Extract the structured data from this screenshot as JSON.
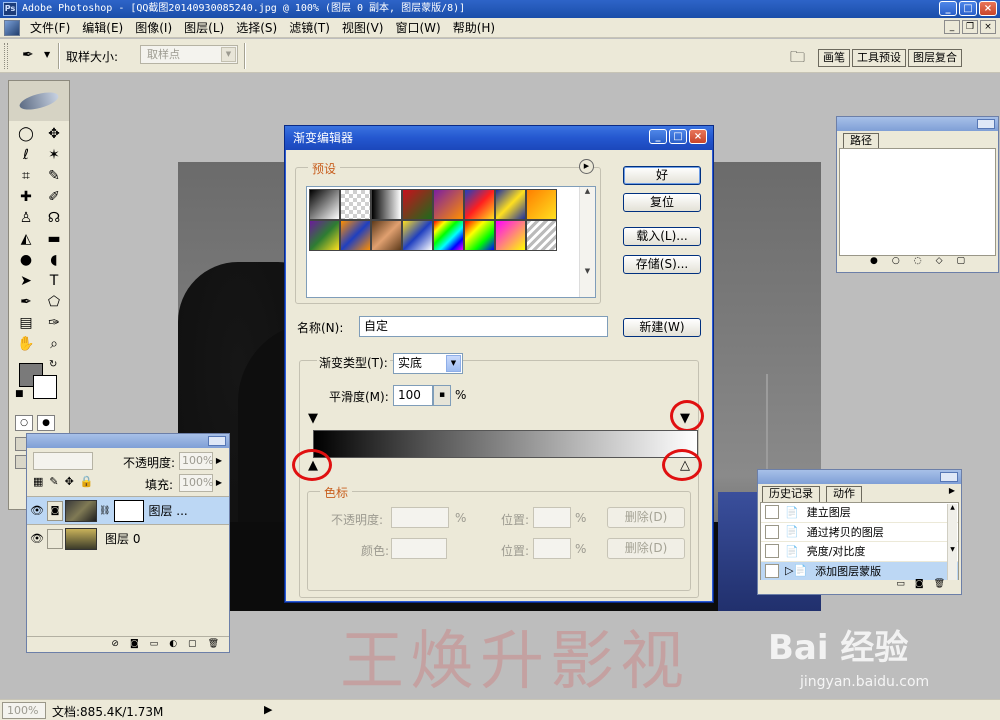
{
  "window": {
    "title": "Adobe Photoshop - [QQ截图20140930085240.jpg @ 100% (图层 0 副本, 图层蒙版/8)]"
  },
  "menu": {
    "items": [
      "文件(F)",
      "编辑(E)",
      "图像(I)",
      "图层(L)",
      "选择(S)",
      "滤镜(T)",
      "视图(V)",
      "窗口(W)",
      "帮助(H)"
    ]
  },
  "options_bar": {
    "sample_size_label": "取样大小:",
    "sample_size_value": "取样点",
    "well_tabs": [
      "画笔",
      "工具预设",
      "图层复合"
    ]
  },
  "toolbox": {
    "tools": [
      "marquee-icon",
      "move-icon",
      "lasso-icon",
      "magic-wand-icon",
      "crop-icon",
      "slice-icon",
      "healing-icon",
      "brush-icon",
      "stamp-icon",
      "history-brush-icon",
      "eraser-icon",
      "gradient-icon",
      "blur-icon",
      "dodge-icon",
      "path-select-icon",
      "type-icon",
      "pen-icon",
      "shape-icon",
      "notes-icon",
      "eyedropper-icon",
      "hand-icon",
      "zoom-icon"
    ],
    "foreground_color": "#7a7a7a",
    "background_color": "#ffffff"
  },
  "layers_panel": {
    "opacity_label": "不透明度:",
    "opacity_value": "100%",
    "fill_label": "填充:",
    "fill_value": "100%",
    "layers": [
      {
        "name": "图层 ...",
        "selected": true,
        "has_mask": true
      },
      {
        "name": "图层 0",
        "selected": false,
        "has_mask": false
      }
    ]
  },
  "paths_panel": {
    "tab": "路径"
  },
  "history_panel": {
    "tabs": [
      "历史记录",
      "动作"
    ],
    "items": [
      {
        "label": "建立图层",
        "selected": false
      },
      {
        "label": "通过拷贝的图层",
        "selected": false
      },
      {
        "label": "亮度/对比度",
        "selected": false
      },
      {
        "label": "添加图层蒙版",
        "selected": true
      }
    ]
  },
  "gradient_editor": {
    "title": "渐变编辑器",
    "presets_label": "预设",
    "buttons": {
      "ok": "好",
      "reset": "复位",
      "load": "载入(L)...",
      "save": "存储(S)...",
      "new": "新建(W)"
    },
    "name_label": "名称(N):",
    "name_value": "自定",
    "gradient_type_label": "渐变类型(T):",
    "gradient_type_value": "实底",
    "smoothness_label": "平滑度(M):",
    "smoothness_value": "100",
    "percent": "%",
    "stops_label": "色标",
    "opacity_label": "不透明度:",
    "color_label": "颜色:",
    "location_label": "位置:",
    "delete_label": "删除(D)",
    "presets": [
      "linear-gradient(135deg,#000,#fff)",
      "repeating-conic-gradient(#cfcfcf 0 25%,#fff 0 50%) 0 0/8px 8px",
      "linear-gradient(90deg,#000,#fff)",
      "linear-gradient(135deg,#c8101c,#1c6c1c)",
      "linear-gradient(135deg,#7b1fa2,#ff8f00)",
      "linear-gradient(135deg,#1f3fc0,#ff1f1f,#ffe01f)",
      "linear-gradient(135deg,#1f2fa0,#ffe01f,#1f2fa0)",
      "linear-gradient(135deg,#ff7f00,#ffe01f)",
      "linear-gradient(135deg,#6a1b9a,#2e7d32,#ffe01f)",
      "linear-gradient(135deg,#ff8f00,#1f3fc0,#ff8f00)",
      "linear-gradient(135deg,#5d3a1a,#e0a070,#5d3a1a)",
      "linear-gradient(135deg,#ffe01f,#1f3fc0,#fff)",
      "linear-gradient(135deg,#ff0000,#ffff00,#00ff00,#00ffff,#0000ff,#ff00ff)",
      "linear-gradient(135deg,#ff0000,#ffff00,#00ff00,#0000ff)",
      "linear-gradient(135deg,#ff00ff,#ffff00)",
      "repeating-linear-gradient(135deg,#bbb 0 3px,#fff 3px 6px)"
    ]
  },
  "status_bar": {
    "zoom": "100%",
    "doc_info": "文档:885.4K/1.73M"
  },
  "watermarks": {
    "author": "王焕升影视",
    "baidu": "Bai 经验",
    "url": "jingyan.baidu.com"
  }
}
